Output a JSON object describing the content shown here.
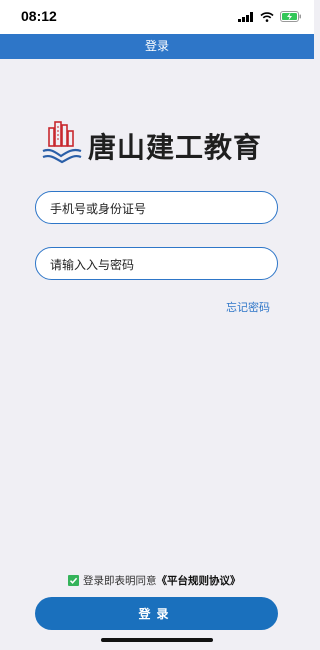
{
  "status_bar": {
    "time": "08:12"
  },
  "nav": {
    "title": "登录"
  },
  "logo": {
    "text": "唐山建工教育"
  },
  "form": {
    "phone_placeholder": "手机号或身份证号",
    "password_placeholder": "请输入入与密码",
    "forgot_label": "忘记密码"
  },
  "agreement": {
    "prefix": "登录即表明同意",
    "link": "《平台规则协议》",
    "checked": true
  },
  "login_button": "登录",
  "colors": {
    "primary": "#1a70bd",
    "nav": "#2e76c8",
    "check": "#35b35a"
  }
}
